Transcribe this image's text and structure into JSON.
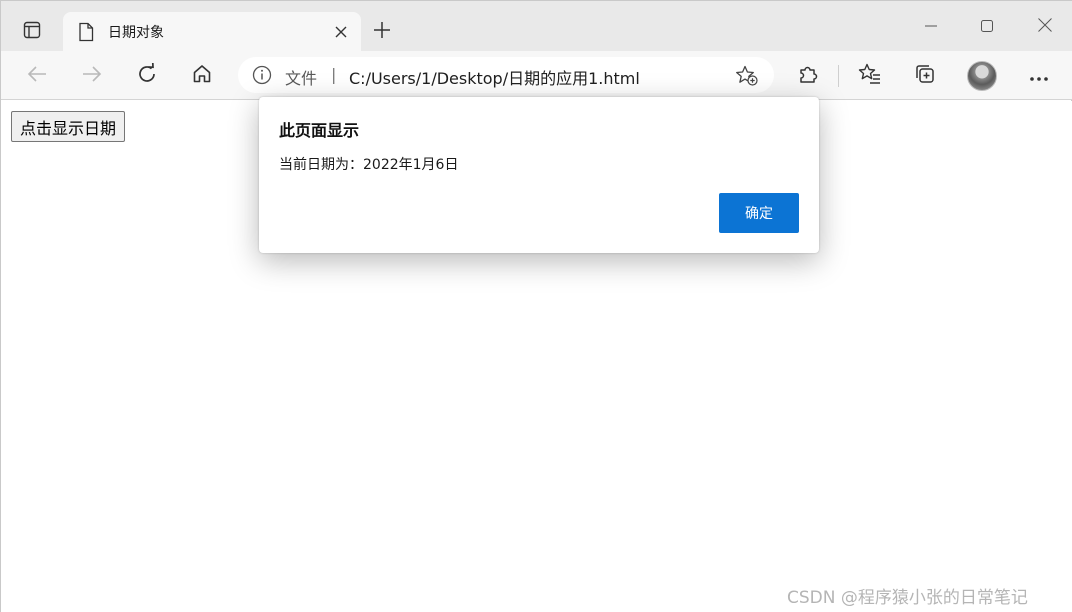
{
  "tab": {
    "title": "日期对象",
    "favicon_icon": "document-icon",
    "close_icon": "close-icon"
  },
  "addressbar": {
    "label": "文件",
    "separator": "|",
    "url": "C:/Users/1/Desktop/日期的应用1.html"
  },
  "page": {
    "button_label": "点击显示日期"
  },
  "dialog": {
    "title": "此页面显示",
    "message": "当前日期为：2022年1月6日",
    "ok_label": "确定",
    "ok_color": "#0c74d4"
  },
  "watermark": "CSDN @程序猿小张的日常笔记",
  "colors": {
    "tabstrip": "#e9e9e9",
    "toolbar": "#f7f7f7",
    "accent": "#0c74d4"
  }
}
